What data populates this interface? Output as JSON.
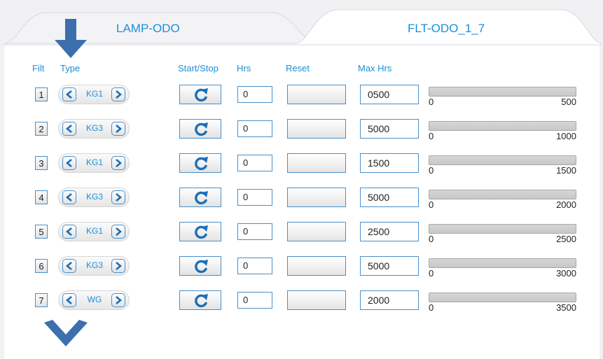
{
  "tabs": [
    {
      "label": "LAMP-ODO",
      "active": false
    },
    {
      "label": "FLT-ODO_1_7",
      "active": true
    }
  ],
  "headers": {
    "filt": "Filt",
    "type": "Type",
    "start_stop": "Start/Stop",
    "hrs": "Hrs",
    "reset": "Reset",
    "max_hrs": "Max Hrs"
  },
  "colors": {
    "accent": "#1a8fd6",
    "border": "#4a8fc7",
    "nav_arrow": "#3d6fae"
  },
  "icons": {
    "scroll_up": "arrow-down-icon",
    "scroll_down": "chevron-down-icon",
    "start_stop": "refresh-icon",
    "prev": "chevron-left-icon",
    "next": "chevron-right-icon"
  },
  "rows": [
    {
      "filt": "1",
      "type": "KG1",
      "hrs": "0",
      "reset": "",
      "max_hrs": "0500",
      "bar_min": "0",
      "bar_max": "500",
      "progress": 0
    },
    {
      "filt": "2",
      "type": "KG3",
      "hrs": "0",
      "reset": "",
      "max_hrs": "5000",
      "bar_min": "0",
      "bar_max": "1000",
      "progress": 0
    },
    {
      "filt": "3",
      "type": "KG1",
      "hrs": "0",
      "reset": "",
      "max_hrs": "1500",
      "bar_min": "0",
      "bar_max": "1500",
      "progress": 0
    },
    {
      "filt": "4",
      "type": "KG3",
      "hrs": "0",
      "reset": "",
      "max_hrs": "5000",
      "bar_min": "0",
      "bar_max": "2000",
      "progress": 0
    },
    {
      "filt": "5",
      "type": "KG1",
      "hrs": "0",
      "reset": "",
      "max_hrs": "2500",
      "bar_min": "0",
      "bar_max": "2500",
      "progress": 0
    },
    {
      "filt": "6",
      "type": "KG3",
      "hrs": "0",
      "reset": "",
      "max_hrs": "5000",
      "bar_min": "0",
      "bar_max": "3000",
      "progress": 0
    },
    {
      "filt": "7",
      "type": "WG",
      "hrs": "0",
      "reset": "",
      "max_hrs": "2000",
      "bar_min": "0",
      "bar_max": "3500",
      "progress": 0
    }
  ]
}
